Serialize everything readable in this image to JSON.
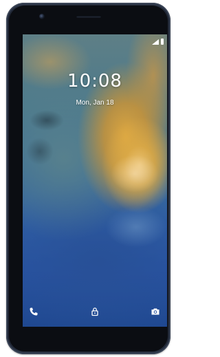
{
  "lockscreen": {
    "time": "10:08",
    "date": "Mon, Jan 18"
  },
  "status_bar": {
    "icons": [
      "signal-icon",
      "battery-icon"
    ]
  },
  "shortcuts": {
    "left": "phone-icon",
    "center": "lock-icon",
    "right": "camera-icon"
  },
  "colors": {
    "phone_body": "#232a38",
    "text": "#ffffff",
    "wallpaper_sand": "#dca54a",
    "wallpaper_sea": "#2853a2"
  }
}
